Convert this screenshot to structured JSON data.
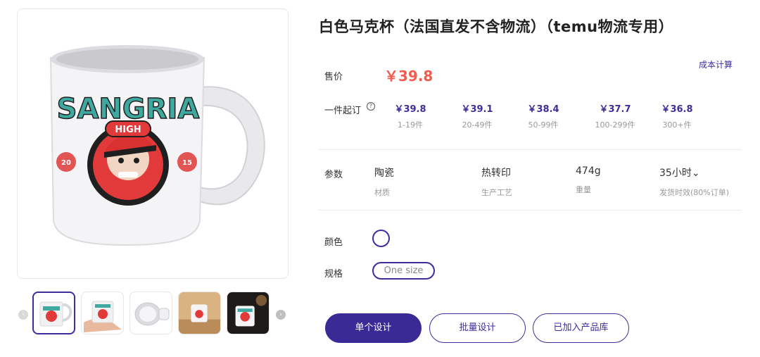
{
  "product": {
    "title": "白色马克杯（法国直发不含物流）（temu物流专用）",
    "cost_link": "成本计算",
    "price_label": "售价",
    "price": "￥39.8",
    "tier_label": "一件起订",
    "help_icon": "question-circle-icon",
    "tiers": [
      {
        "price": "￥39.8",
        "qty": "1-19件"
      },
      {
        "price": "￥39.1",
        "qty": "20-49件"
      },
      {
        "price": "￥38.4",
        "qty": "50-99件"
      },
      {
        "price": "￥37.7",
        "qty": "100-299件"
      },
      {
        "price": "￥36.8",
        "qty": "300+件"
      }
    ]
  },
  "params": {
    "label": "参数",
    "items": [
      {
        "value": "陶瓷",
        "name": "材质"
      },
      {
        "value": "热转印",
        "name": "生产工艺"
      },
      {
        "value": "474g",
        "name": "重量"
      },
      {
        "value": "35小时⌄",
        "name": "发货时效(80%订单)"
      }
    ]
  },
  "options": {
    "color_label": "颜色",
    "size_label": "规格",
    "size_value": "One size",
    "color_value": "#ffffff"
  },
  "buttons": {
    "single_design": "单个设计",
    "batch_design": "批量设计",
    "added_library": "已加入产品库"
  },
  "gallery": {
    "left_arrow": "‹",
    "right_arrow": "›",
    "mug_text_top": "SANGRIA",
    "mug_text_mid": "HIGH",
    "mug_year_left": "20",
    "mug_year_right": "15"
  },
  "colors": {
    "accent": "#3f2d9c",
    "price": "#f25c4d"
  }
}
